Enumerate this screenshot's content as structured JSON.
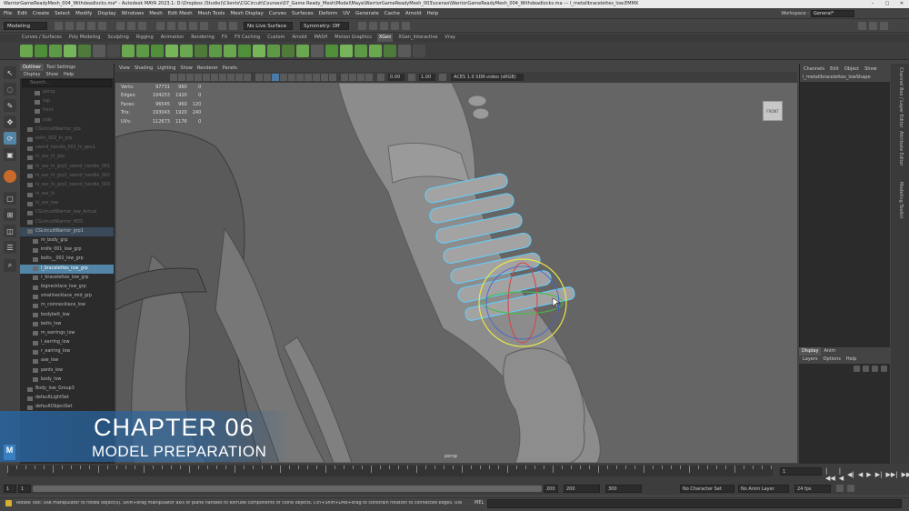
{
  "titlebar": {
    "title": "WarriorGameReadyMesh_004_Withdeadlocks.ma* - Autodesk MAYA 2023.1: D:\\Dropbox (Studio)\\Clients\\CGCircuit\\Courses\\07_Game Ready_Mesh\\Model\\Maya\\WarriorGameReadyMesh_003\\scenes\\WarriorGameReadyMesh_004_Withdeadlocks.ma   ---   l_metallbracelettes_low.EMMX"
  },
  "menubar": {
    "items": [
      "File",
      "Edit",
      "Create",
      "Select",
      "Modify",
      "Display",
      "Windows",
      "Mesh",
      "Edit Mesh",
      "Mesh Tools",
      "Mesh Display",
      "Curves",
      "Surfaces",
      "Deform",
      "UV",
      "Generate",
      "Cache",
      "Arnold",
      "Help"
    ],
    "workspace_label": "Workspace :",
    "workspace_value": "General*"
  },
  "statusline": {
    "mode": "Modeling",
    "surface": "No Live Surface",
    "symmetry": "Symmetry: Off"
  },
  "shelf_tabs": {
    "items": [
      "Curves / Surfaces",
      "Poly Modeling",
      "Sculpting",
      "Rigging",
      "Animation",
      "Rendering",
      "FX",
      "FX Caching",
      "Custom",
      "Arnold",
      "MASH",
      "Motion Graphics",
      "XGen",
      "XGen_Interactive",
      "Vray"
    ],
    "active": "XGen"
  },
  "outliner": {
    "tabs": [
      "Outliner",
      "Tool Settings"
    ],
    "menus": [
      "Display",
      "Show",
      "Help"
    ],
    "search_placeholder": "Search...",
    "items": [
      {
        "label": "persp",
        "style": "dim"
      },
      {
        "label": "top",
        "style": "dim"
      },
      {
        "label": "front",
        "style": "dim"
      },
      {
        "label": "side",
        "style": "dim"
      },
      {
        "label": "CGcircuitWarrior_grp",
        "style": "dim"
      },
      {
        "label": "bolts_002_hi_grp",
        "style": "dim"
      },
      {
        "label": "sword_handle_001_hi_geo1",
        "style": "dim"
      },
      {
        "label": "hi_ear_hi_grp",
        "style": "dim"
      },
      {
        "label": "hi_ear_hi_grp1_sword_handle_001",
        "style": "dim"
      },
      {
        "label": "hi_ear_hi_grp1_sword_handle_002",
        "style": "dim"
      },
      {
        "label": "hi_ear_hi_grp1_sword_handle_003",
        "style": "dim"
      },
      {
        "label": "hi_ear_hi",
        "style": "dim"
      },
      {
        "label": "hi_ear_low",
        "style": "dim"
      },
      {
        "label": "CGcircuitWarrior_low_Actual",
        "style": "dim"
      },
      {
        "label": "CGcircuitWarrior_HDS",
        "style": "dim"
      },
      {
        "label": "CGcircuitWarrior_grp1",
        "style": "hl"
      },
      {
        "label": "m_body_grp",
        "style": ""
      },
      {
        "label": "knife_001_low_grp",
        "style": ""
      },
      {
        "label": "bolts__002_low_grp",
        "style": ""
      },
      {
        "label": "l_bracelettes_low_grp",
        "style": "sel"
      },
      {
        "label": "r_bracelettes_low_grp",
        "style": ""
      },
      {
        "label": "bignecklace_low_grp",
        "style": ""
      },
      {
        "label": "smallnecklace_mid_grp",
        "style": ""
      },
      {
        "label": "m_coinnecklace_low",
        "style": ""
      },
      {
        "label": "bodybelt_low",
        "style": ""
      },
      {
        "label": "belts_low",
        "style": ""
      },
      {
        "label": "m_earrings_low",
        "style": ""
      },
      {
        "label": "l_earring_low",
        "style": ""
      },
      {
        "label": "r_earring_low",
        "style": ""
      },
      {
        "label": "axe_low",
        "style": ""
      },
      {
        "label": "pants_low",
        "style": ""
      },
      {
        "label": "body_low",
        "style": ""
      },
      {
        "label": "Body_low_Group3",
        "style": ""
      },
      {
        "label": "defaultLightSet",
        "style": ""
      },
      {
        "label": "defaultObjectSet",
        "style": ""
      }
    ]
  },
  "viewport": {
    "menu": [
      "View",
      "Shading",
      "Lighting",
      "Show",
      "Renderer",
      "Panels"
    ],
    "exposure": "0.00",
    "gamma": "1.00",
    "colorspace": "ACES 1.0 SDR-video (sRGB)",
    "hud": [
      {
        "label": "Verts:",
        "a": "97731",
        "b": "960",
        "c": "0"
      },
      {
        "label": "Edges:",
        "a": "194253",
        "b": "1920",
        "c": "0"
      },
      {
        "label": "Faces:",
        "a": "96545",
        "b": "960",
        "c": "120"
      },
      {
        "label": "Tris:",
        "a": "193043",
        "b": "1920",
        "c": "240"
      },
      {
        "label": "UVs:",
        "a": "112673",
        "b": "1176",
        "c": "0"
      }
    ],
    "viewcube_label": "FRONT",
    "camera_name": "persp"
  },
  "chapter": {
    "title": "CHAPTER 06",
    "subtitle": "MODEL PREPARATION",
    "logo": "M"
  },
  "channelbox": {
    "menus": [
      "Channels",
      "Edit",
      "Object",
      "Show"
    ],
    "object_name": "l_metallbracelettes_lowShape"
  },
  "layers": {
    "tabs": [
      "Display",
      "Anim"
    ],
    "menus": [
      "Layers",
      "Options",
      "Help"
    ]
  },
  "right_strip": [
    "Channel Box / Layer Editor",
    "Attribute Editor",
    "Modeling Toolkit"
  ],
  "timeslider": {
    "current_frame": "1",
    "playback_icons": [
      "|◀◀",
      "|◀",
      "◀|",
      "◀",
      "▶",
      "▶|",
      "▶▶|",
      "▶▶|"
    ]
  },
  "range": {
    "start": "1",
    "inner_start": "1",
    "inner_end": "200",
    "end": "200",
    "end2": "300",
    "character_set": "No Character Set",
    "anim_layer": "No Anim Layer",
    "fps": "24 fps"
  },
  "helpline": {
    "text": "Rotate Tool: Use manipulator to rotate object(s). Shift+drag manipulator axis or plane handles to extrude components or clone objects. Ctrl+Shift+LMB+drag to constrain rotation to connected edges. Use D or INSERT to change the pivot position and axis orientation.",
    "mel_label": "MEL"
  },
  "colors": {
    "selection": "#5285a6",
    "wireframe": "#5fd0ff",
    "manip_yellow": "#e7e74a",
    "chapter_blue": "#2864a0"
  }
}
